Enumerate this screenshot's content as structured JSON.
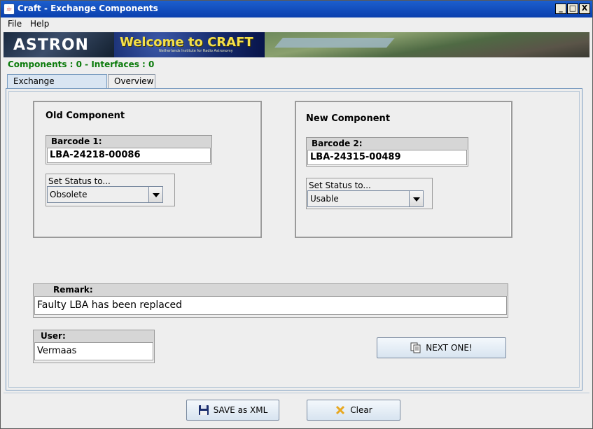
{
  "window": {
    "title": "Craft - Exchange Components",
    "controls": {
      "minimize": "_",
      "maximize": "□",
      "close": "X"
    }
  },
  "menu": {
    "file": "File",
    "help": "Help"
  },
  "banner": {
    "logo_text": "ASTRON",
    "welcome": "Welcome to CRAFT",
    "subtitle": "Netherlands Institute for Radio Astronomy"
  },
  "status": {
    "counts": "Components : 0 - Interfaces : 0"
  },
  "tabs": [
    {
      "label": "Exchange Component",
      "active": true
    },
    {
      "label": "Overview",
      "active": false
    }
  ],
  "old_component": {
    "title": "Old Component",
    "barcode_label": "Barcode 1:",
    "barcode_value": "LBA-24218-00086",
    "status_label": "Set Status to...",
    "status_value": "Obsolete"
  },
  "new_component": {
    "title": "New Component",
    "barcode_label": "Barcode 2:",
    "barcode_value": "LBA-24315-00489",
    "status_label": "Set Status to...",
    "status_value": "Usable"
  },
  "remark": {
    "label": "Remark:",
    "value": "Faulty LBA has been replaced"
  },
  "user": {
    "label": "User:",
    "value": "Vermaas"
  },
  "buttons": {
    "next": "NEXT ONE!",
    "save": "SAVE as XML",
    "clear": "Clear"
  },
  "icons": {
    "app": "java-cup-icon",
    "next": "document-stack-icon",
    "save": "floppy-disk-icon",
    "clear": "x-mark-icon"
  },
  "colors": {
    "counts_text": "#0a7a0a",
    "titlebar": "#0a3fae",
    "clear_icon": "#e8a820"
  }
}
